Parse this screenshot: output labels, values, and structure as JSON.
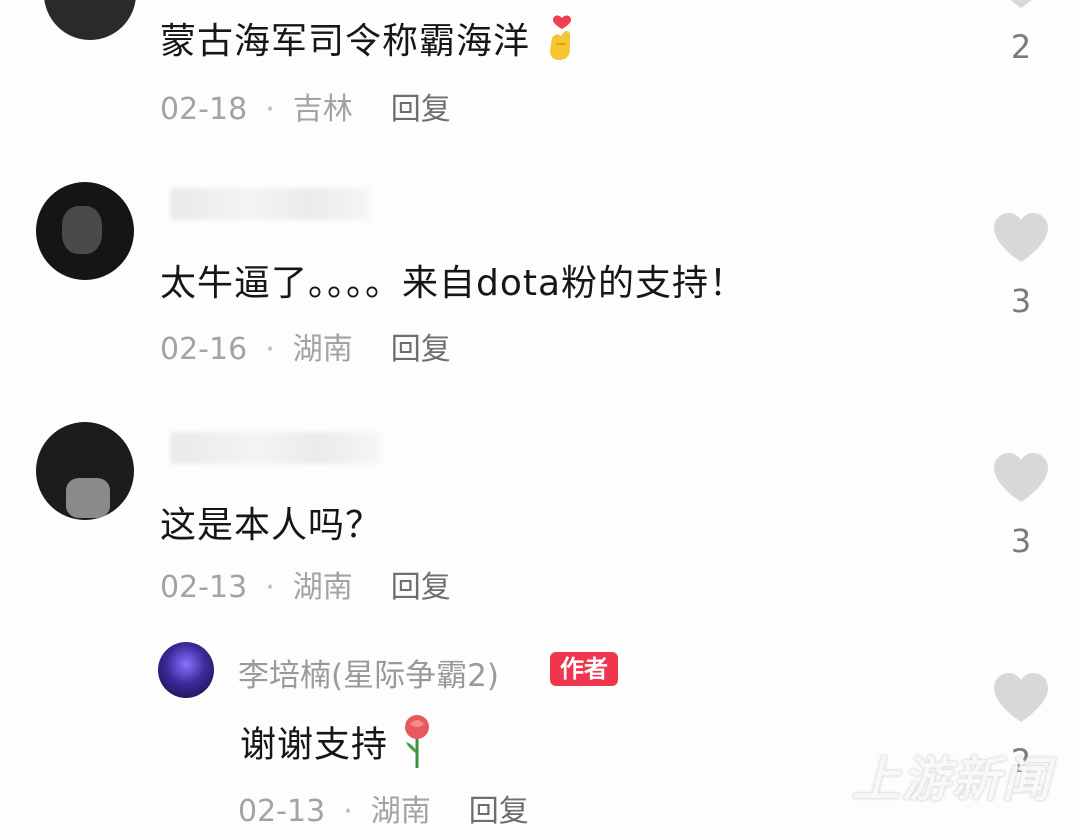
{
  "comments": [
    {
      "text": "蒙古海军司令称霸海洋",
      "emoji": "finger-heart-icon",
      "date": "02-18",
      "location": "吉林",
      "reply_label": "回复",
      "likes": "2"
    },
    {
      "text": "太牛逼了。。。。来自dota粉的支持！",
      "date": "02-16",
      "location": "湖南",
      "reply_label": "回复",
      "likes": "3"
    },
    {
      "text": "这是本人吗？",
      "date": "02-13",
      "location": "湖南",
      "reply_label": "回复",
      "likes": "3"
    }
  ],
  "reply": {
    "username": "李培楠(星际争霸2)",
    "badge": "作者",
    "text": "谢谢支持",
    "emoji": "rose-icon",
    "date": "02-13",
    "location": "湖南",
    "reply_label": "回复",
    "likes": "2"
  },
  "meta_separator": "·",
  "watermark": "上游新闻",
  "colors": {
    "badge": "#f0354f",
    "heart": "#d8d8d8",
    "text": "#161616",
    "meta": "#a3a3a3"
  }
}
